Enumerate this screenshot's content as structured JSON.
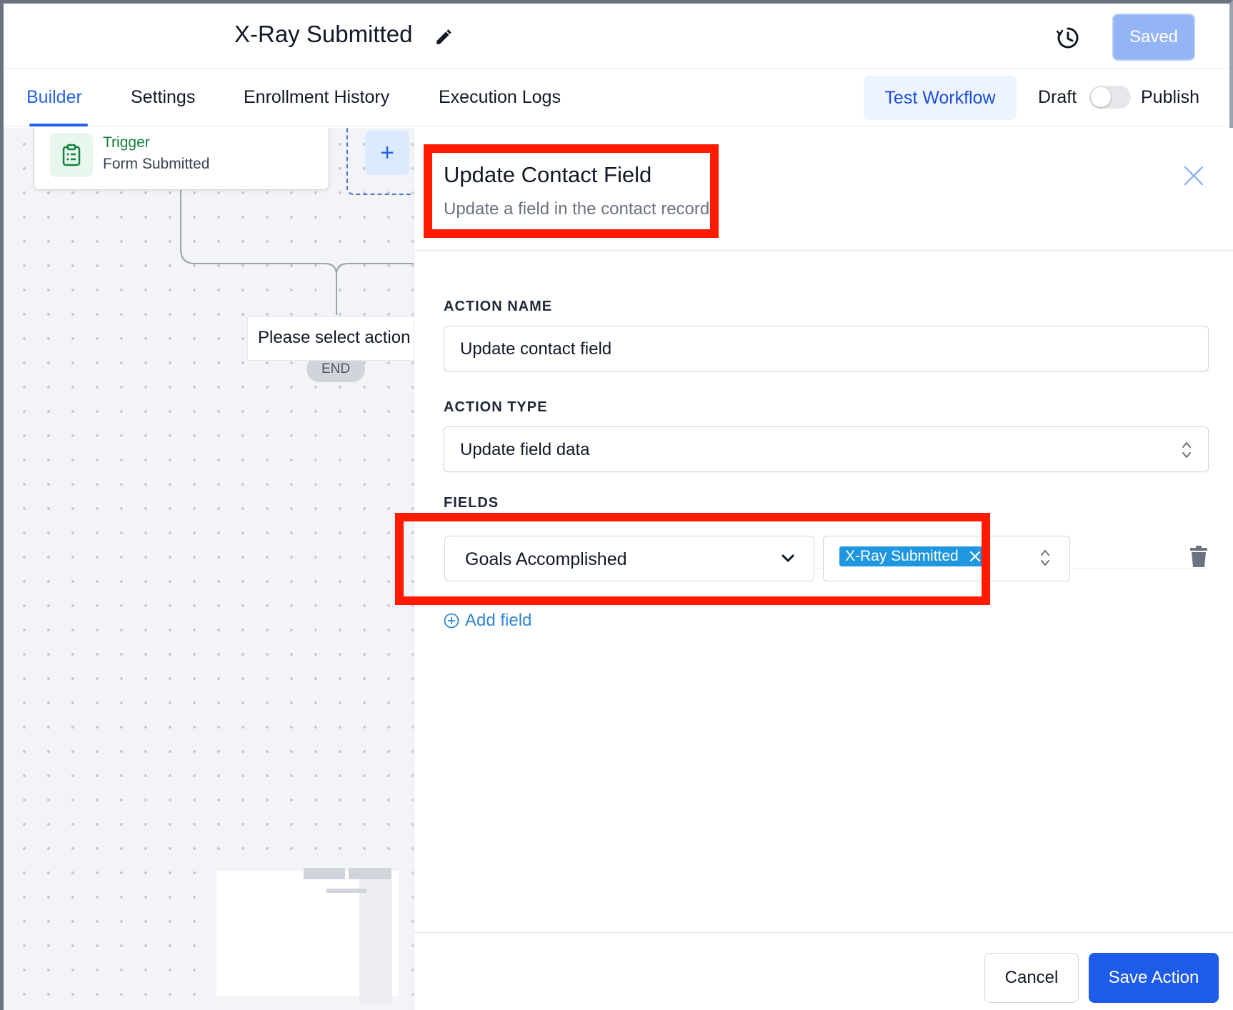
{
  "header": {
    "workflow_title": "X-Ray Submitted",
    "saved_label": "Saved"
  },
  "tabs": [
    {
      "label": "Builder",
      "active": true
    },
    {
      "label": "Settings",
      "active": false
    },
    {
      "label": "Enrollment History",
      "active": false
    },
    {
      "label": "Execution Logs",
      "active": false
    }
  ],
  "toolbar": {
    "test_label": "Test Workflow",
    "draft_label": "Draft",
    "publish_label": "Publish",
    "publish_toggle_on": false
  },
  "canvas": {
    "trigger_label": "Trigger",
    "trigger_name": "Form Submitted",
    "add_symbol": "+",
    "placeholder_text": "Please select action",
    "end_label": "END"
  },
  "panel": {
    "title": "Update Contact Field",
    "subtitle": "Update a field in the contact record",
    "action_name_label": "ACTION NAME",
    "action_name_value": "Update contact field",
    "action_type_label": "ACTION TYPE",
    "action_type_value": "Update field data",
    "fields_label": "FIELDS",
    "field_name": "Goals Accomplished",
    "field_value_chip": "X-Ray Submitted",
    "add_field_label": "Add field",
    "cancel_label": "Cancel",
    "save_label": "Save Action"
  },
  "colors": {
    "accent": "#2563eb",
    "highlight": "#ff1a00",
    "chip": "#1f97e0",
    "trigger_green": "#15803d"
  },
  "icons": [
    "edit-icon",
    "history-icon",
    "clipboard-icon",
    "close-icon",
    "chevron-down-icon",
    "up-down-arrows-icon",
    "trash-icon",
    "plus-circle-icon"
  ]
}
